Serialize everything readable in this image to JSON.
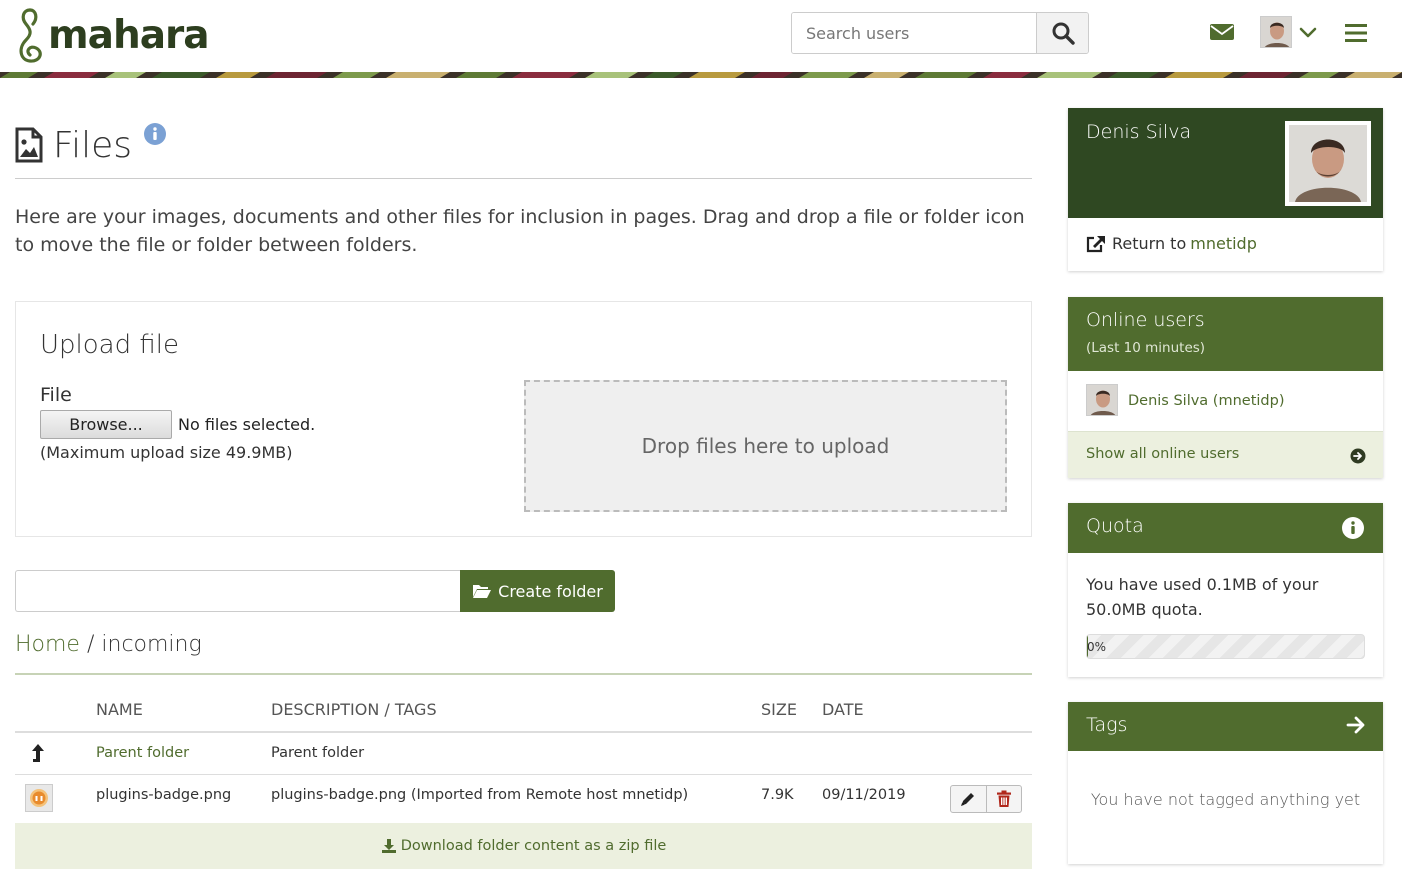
{
  "header": {
    "logo_text": "mahara",
    "search_placeholder": "Search users",
    "icons": {
      "search": "search-icon",
      "mail": "envelope-icon",
      "chevron": "chevron-down-icon",
      "menu": "hamburger-menu-icon"
    }
  },
  "colors": {
    "brand_dark": "#2f4822",
    "brand": "#506c2e",
    "brand_light": "#ecf0df"
  },
  "page": {
    "title": "Files",
    "intro": "Here are your images, documents and other files for inclusion in pages. Drag and drop a file or folder icon to move the file or folder between folders."
  },
  "upload": {
    "title": "Upload file",
    "file_label": "File",
    "browse_label": "Browse...",
    "no_files": "No files selected.",
    "max_size": "(Maximum upload size 49.9MB)",
    "dropzone": "Drop files here to upload"
  },
  "folder": {
    "create_label": "Create folder",
    "input_value": ""
  },
  "breadcrumb": {
    "home": "Home",
    "separator": "/",
    "current": "incoming"
  },
  "table": {
    "columns": [
      "NAME",
      "DESCRIPTION / TAGS",
      "SIZE",
      "DATE"
    ],
    "rows": [
      {
        "name": "Parent folder",
        "description": "Parent folder",
        "size": "",
        "date": ""
      },
      {
        "name": "plugins-badge.png",
        "description": "plugins-badge.png (Imported from Remote host mnetidp)",
        "size": "7.9K",
        "date": "09/11/2019"
      }
    ],
    "download_zip": "Download folder content as a zip file"
  },
  "sidebar": {
    "user": {
      "name": "Denis Silva",
      "return_prefix": "Return to",
      "return_host": "mnetidp"
    },
    "online": {
      "title": "Online users",
      "subtitle": "(Last 10 minutes)",
      "users": [
        "Denis Silva (mnetidp)"
      ],
      "show_all": "Show all online users"
    },
    "quota": {
      "title": "Quota",
      "text": "You have used 0.1MB of your 50.0MB quota.",
      "percent_label": "0%",
      "used_fraction": 0.002
    },
    "tags": {
      "title": "Tags",
      "empty": "You have not tagged anything yet"
    }
  }
}
